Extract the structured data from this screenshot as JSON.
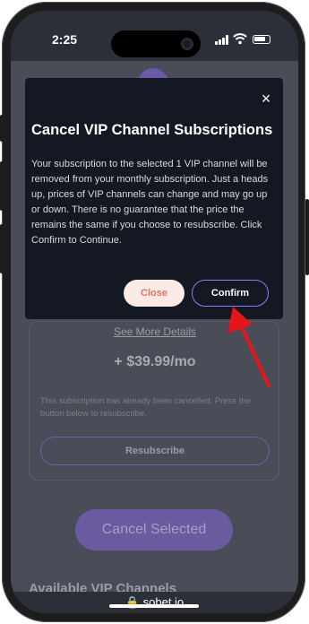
{
  "status_bar": {
    "time": "2:25"
  },
  "modal": {
    "title": "Cancel VIP Channel Subscriptions",
    "body": "Your subscription to the selected 1 VIP channel will be removed from your monthly subscription. Just a heads up, prices of VIP channels can change and may go up or down. There is no guarantee that the price the remains the same if you choose to resubscribe. Click Confirm to Continue.",
    "close_label": "Close",
    "confirm_label": "Confirm",
    "close_icon": "×"
  },
  "background": {
    "see_more": "See More Details",
    "price": "+ $39.99/mo",
    "cancelled_note": "This subscription has already been cancelled. Press the button below to resubscribe.",
    "resubscribe_label": "Resubscribe",
    "cancel_selected_label": "Cancel Selected",
    "available_heading": "Available VIP Channels"
  },
  "browser": {
    "url": "🔒 sobet.io"
  },
  "colors": {
    "accent": "#8b7ff0",
    "annotation_arrow": "#e8141c",
    "close_button_bg": "#fbeae6",
    "close_button_text": "#e0735f"
  },
  "icons": [
    "close-icon",
    "signal-icon",
    "wifi-icon",
    "battery-icon",
    "lock-icon",
    "arrow-annotation-icon"
  ]
}
